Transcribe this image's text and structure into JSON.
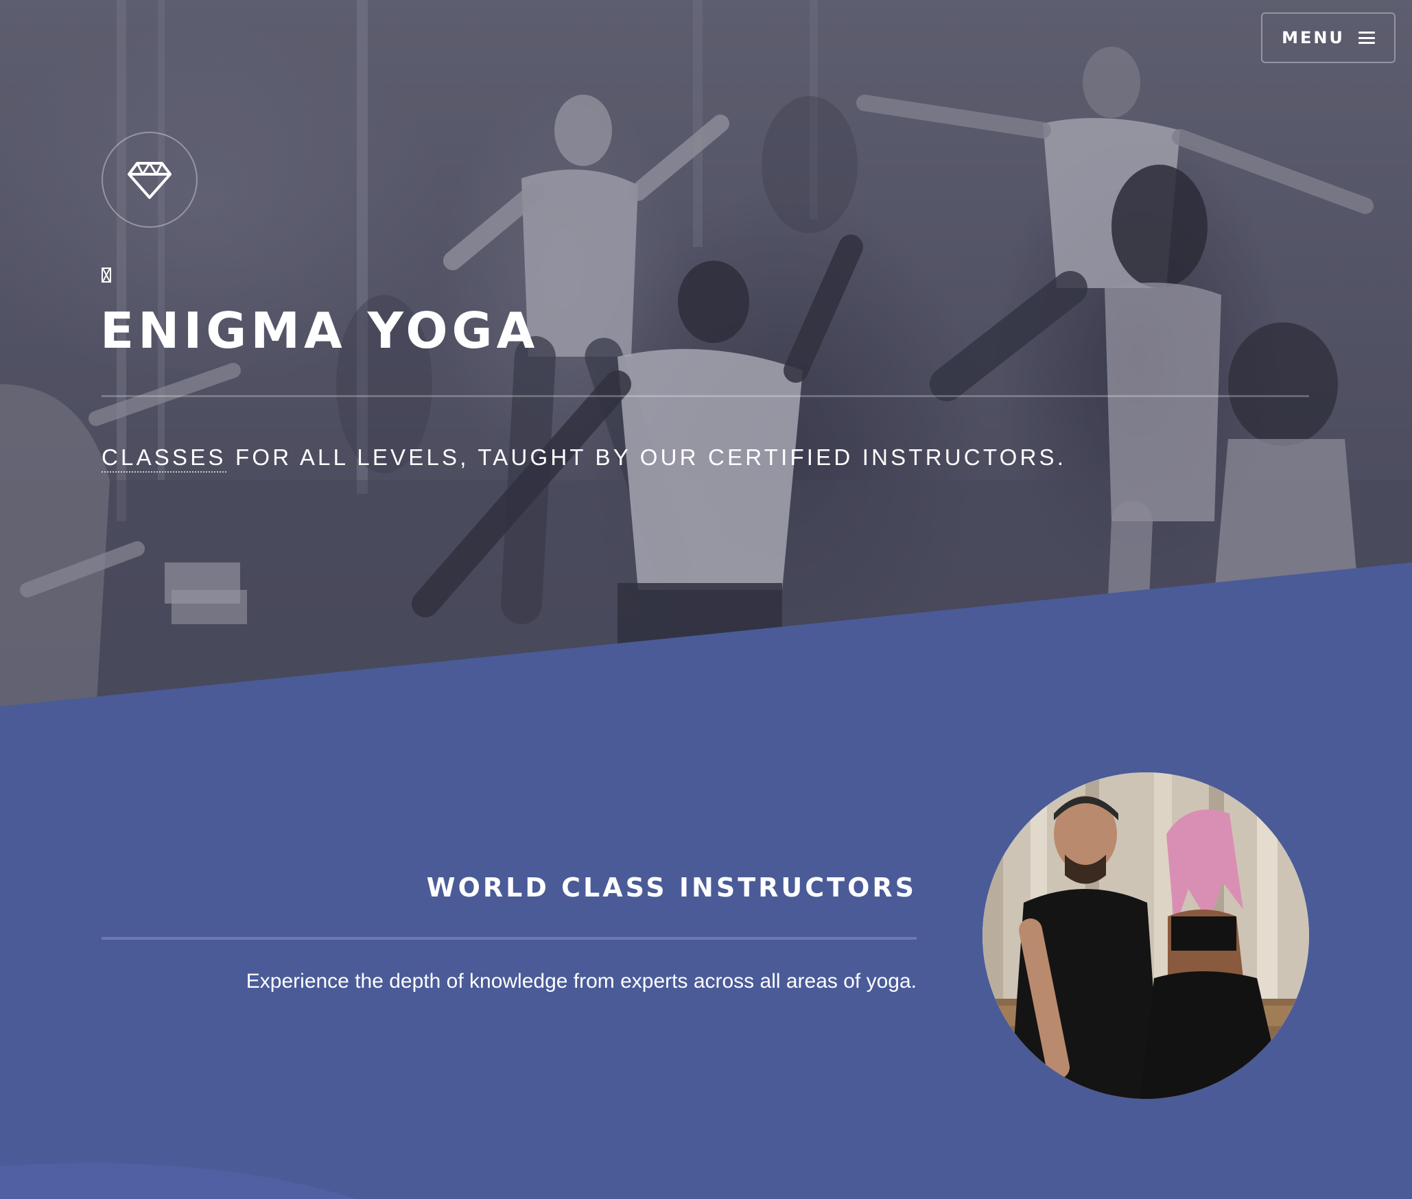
{
  "header": {
    "menu_label": "MENU",
    "menu_icon": "hamburger-icon"
  },
  "hero": {
    "logo_icon": "diamond-icon",
    "title": "ENIGMA YOGA",
    "tagline_link_word": "CLASSES",
    "tagline_rest": " FOR ALL LEVELS, TAUGHT BY OUR CERTIFIED INSTRUCTORS."
  },
  "feature": {
    "title": "WORLD CLASS INSTRUCTORS",
    "text": "Experience the depth of knowledge from experts across all areas of yoga."
  },
  "colors": {
    "section_background": "#4a5b98",
    "hero_tint": "#5f606e",
    "text": "#ffffff"
  }
}
